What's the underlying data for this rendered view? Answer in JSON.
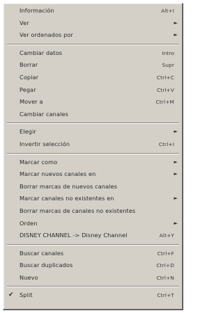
{
  "menu": {
    "groups": [
      [
        {
          "label": "Información",
          "shortcut": "Alt+I",
          "submenu": false,
          "checked": false
        },
        {
          "label": "Ver",
          "shortcut": "",
          "submenu": true,
          "checked": false
        },
        {
          "label": "Ver ordenados por",
          "shortcut": "",
          "submenu": true,
          "checked": false
        }
      ],
      [
        {
          "label": "Cambiar datos",
          "shortcut": "Intro",
          "submenu": false,
          "checked": false
        },
        {
          "label": "Borrar",
          "shortcut": "Supr",
          "submenu": false,
          "checked": false
        },
        {
          "label": "Copiar",
          "shortcut": "Ctrl+C",
          "submenu": false,
          "checked": false
        },
        {
          "label": "Pegar",
          "shortcut": "Ctrl+V",
          "submenu": false,
          "checked": false
        },
        {
          "label": "Mover a",
          "shortcut": "Ctrl+M",
          "submenu": false,
          "checked": false
        },
        {
          "label": "Cambiar canales",
          "shortcut": "",
          "submenu": false,
          "checked": false
        }
      ],
      [
        {
          "label": "Elegir",
          "shortcut": "",
          "submenu": true,
          "checked": false
        },
        {
          "label": "Invertir selección",
          "shortcut": "Ctrl+I",
          "submenu": false,
          "checked": false
        }
      ],
      [
        {
          "label": "Marcar como",
          "shortcut": "",
          "submenu": true,
          "checked": false
        },
        {
          "label": "Marcar nuevos canales en",
          "shortcut": "",
          "submenu": true,
          "checked": false
        },
        {
          "label": "Borrar marcas de nuevos canales",
          "shortcut": "",
          "submenu": false,
          "checked": false
        },
        {
          "label": "Marcar canales no existentes en",
          "shortcut": "",
          "submenu": true,
          "checked": false
        },
        {
          "label": "Borrar marcas de canales no existentes",
          "shortcut": "",
          "submenu": false,
          "checked": false
        },
        {
          "label": "Orden",
          "shortcut": "",
          "submenu": true,
          "checked": false
        },
        {
          "label": "DISNEY CHANNEL -> Disney Channel",
          "shortcut": "Alt+Y",
          "submenu": false,
          "checked": false
        }
      ],
      [
        {
          "label": "Buscar canales",
          "shortcut": "Ctrl+F",
          "submenu": false,
          "checked": false
        },
        {
          "label": "Buscar duplicados",
          "shortcut": "Ctrl+D",
          "submenu": false,
          "checked": false
        },
        {
          "label": "Nuevo",
          "shortcut": "Ctrl+N",
          "submenu": false,
          "checked": false
        }
      ],
      [
        {
          "label": "Split",
          "shortcut": "Ctrl+T",
          "submenu": false,
          "checked": true
        }
      ]
    ],
    "submenu_glyph": "►",
    "check_glyph": "✔"
  },
  "colors": {
    "menu_bg": "#d4d0c8",
    "text": "#2a2a2a"
  }
}
